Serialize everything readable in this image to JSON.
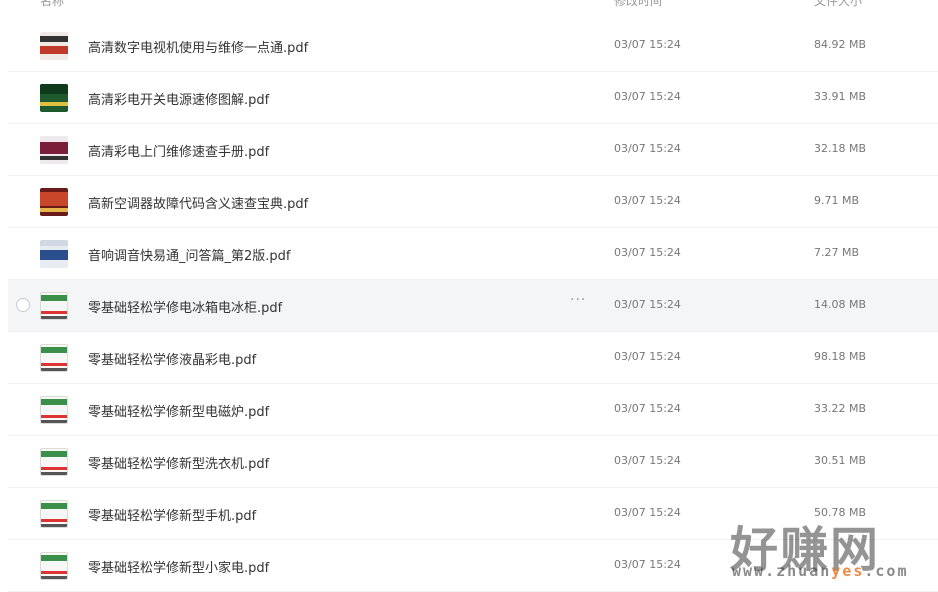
{
  "header": {
    "name_label": "名称",
    "sort_icon": "chevron-down-icon",
    "time_label": "修改时间",
    "size_label": "文件大小"
  },
  "files": [
    {
      "name": "高清数字电视机使用与维修一点通.pdf",
      "time": "03/07 15:24",
      "size": "84.92 MB",
      "thumb": "red"
    },
    {
      "name": "高清彩电开关电源速修图解.pdf",
      "time": "03/07 15:24",
      "size": "33.91 MB",
      "thumb": "green"
    },
    {
      "name": "高清彩电上门维修速查手册.pdf",
      "time": "03/07 15:24",
      "size": "32.18 MB",
      "thumb": "wine"
    },
    {
      "name": "高新空调器故障代码含义速查宝典.pdf",
      "time": "03/07 15:24",
      "size": "9.71 MB",
      "thumb": "orange"
    },
    {
      "name": "音响调音快易通_问答篇_第2版.pdf",
      "time": "03/07 15:24",
      "size": "7.27 MB",
      "thumb": "blue"
    },
    {
      "name": "零基础轻松学修电冰箱电冰柜.pdf",
      "time": "03/07 15:24",
      "size": "14.08 MB",
      "thumb": "white"
    },
    {
      "name": "零基础轻松学修液晶彩电.pdf",
      "time": "03/07 15:24",
      "size": "98.18 MB",
      "thumb": "white"
    },
    {
      "name": "零基础轻松学修新型电磁炉.pdf",
      "time": "03/07 15:24",
      "size": "33.22 MB",
      "thumb": "white"
    },
    {
      "name": "零基础轻松学修新型洗衣机.pdf",
      "time": "03/07 15:24",
      "size": "30.51 MB",
      "thumb": "white"
    },
    {
      "name": "零基础轻松学修新型手机.pdf",
      "time": "03/07 15:24",
      "size": "50.78 MB",
      "thumb": "white"
    },
    {
      "name": "零基础轻松学修新型小家电.pdf",
      "time": "03/07 15:24",
      "size": "",
      "thumb": "white"
    }
  ],
  "hover_row": 5,
  "more_label": "···",
  "watermark": {
    "brand": "好赚网",
    "url_prefix": "www.zhuan",
    "url_accent": "yes",
    "url_suffix": ".com"
  },
  "colors": {
    "row_hover": "#f4f5f7",
    "divider": "#eef0f3",
    "text": "#333333",
    "meta": "#777777"
  }
}
